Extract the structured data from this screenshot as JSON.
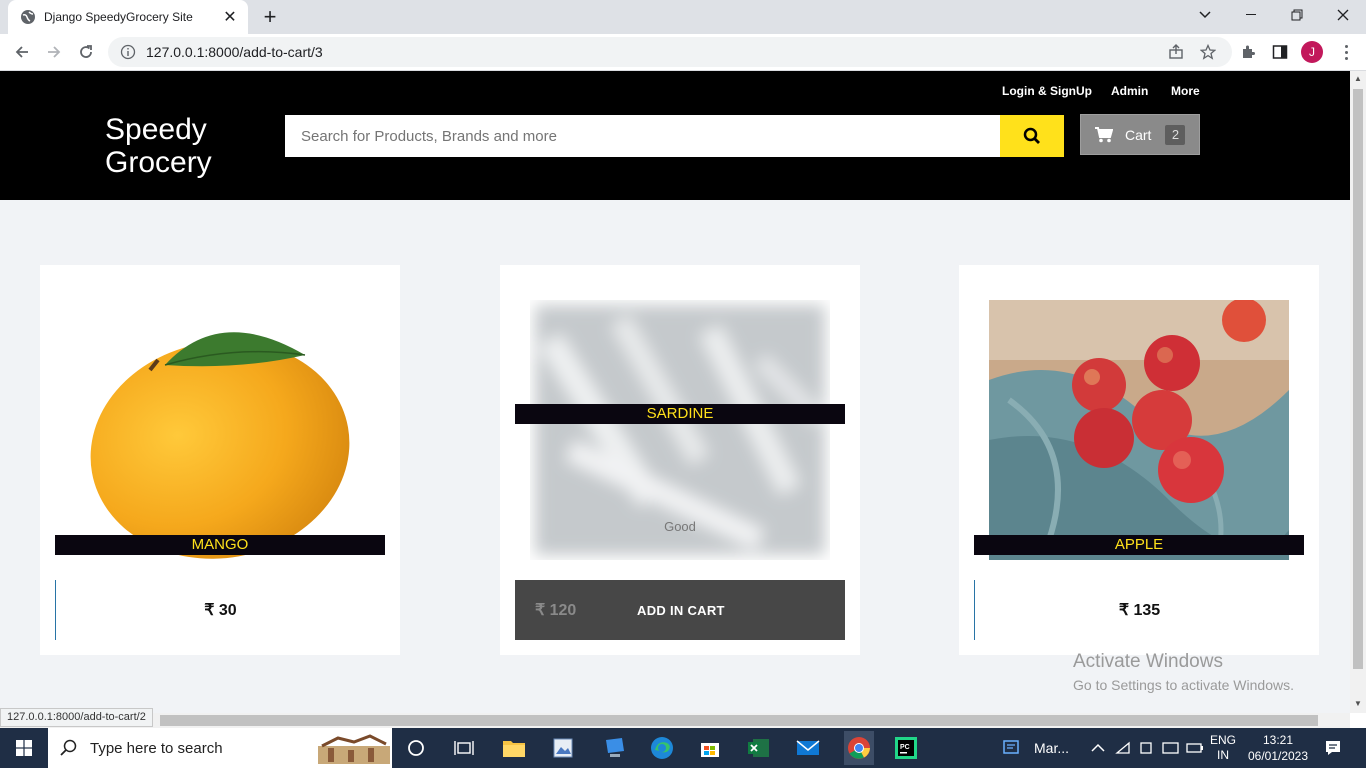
{
  "browser": {
    "tab_title": "Django SpeedyGrocery Site",
    "url": "127.0.0.1:8000/add-to-cart/3",
    "profile_initial": "J",
    "status_url": "127.0.0.1:8000/add-to-cart/2"
  },
  "site": {
    "brand_line1": "Speedy",
    "brand_line2": "Grocery",
    "nav": {
      "login": "Login & SignUp",
      "admin": "Admin",
      "more": "More"
    },
    "search_placeholder": "Search for Products, Brands and more",
    "cart_label": "Cart",
    "cart_count": "2"
  },
  "products": [
    {
      "name": "MANGO",
      "price": "₹ 30"
    },
    {
      "name": "SARDINE",
      "price": "₹ 120",
      "description": "Good",
      "add_label": "ADD IN CART"
    },
    {
      "name": "APPLE",
      "price": "₹ 135"
    }
  ],
  "watermark": {
    "line1": "Activate Windows",
    "line2": "Go to Settings to activate Windows."
  },
  "taskbar": {
    "search_text": "Type here to search",
    "app_label": "Mar...",
    "lang_line1": "ENG",
    "lang_line2": "IN",
    "time": "13:21",
    "date": "06/01/2023"
  },
  "colors": {
    "accent_yellow": "#ffe11b",
    "header_bg": "#000000",
    "page_bg": "#f1f3f6"
  }
}
